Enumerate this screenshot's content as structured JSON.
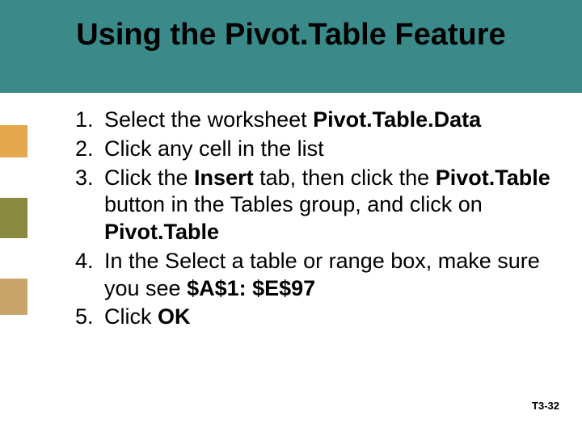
{
  "title": "Using the Pivot.Table Feature",
  "steps": {
    "s1a": "Select the worksheet ",
    "s1b": "Pivot.Table.Data",
    "s2": "Click any cell in the list",
    "s3a": "Click the ",
    "s3b": "Insert",
    "s3c": " tab, then click the ",
    "s3d": "Pivot.Table",
    "s3e": " button in the Tables group, and click on ",
    "s3f": "Pivot.Table",
    "s4a": "In the Select a table or range box, make sure you see ",
    "s4b": "$A$1: $E$97",
    "s5a": "Click ",
    "s5b": "OK"
  },
  "footer": "T3-32",
  "colors": {
    "teal": "#3a8a8a",
    "orange": "#e5a84d",
    "olive": "#8a8a3f",
    "tan": "#c9a56b"
  }
}
